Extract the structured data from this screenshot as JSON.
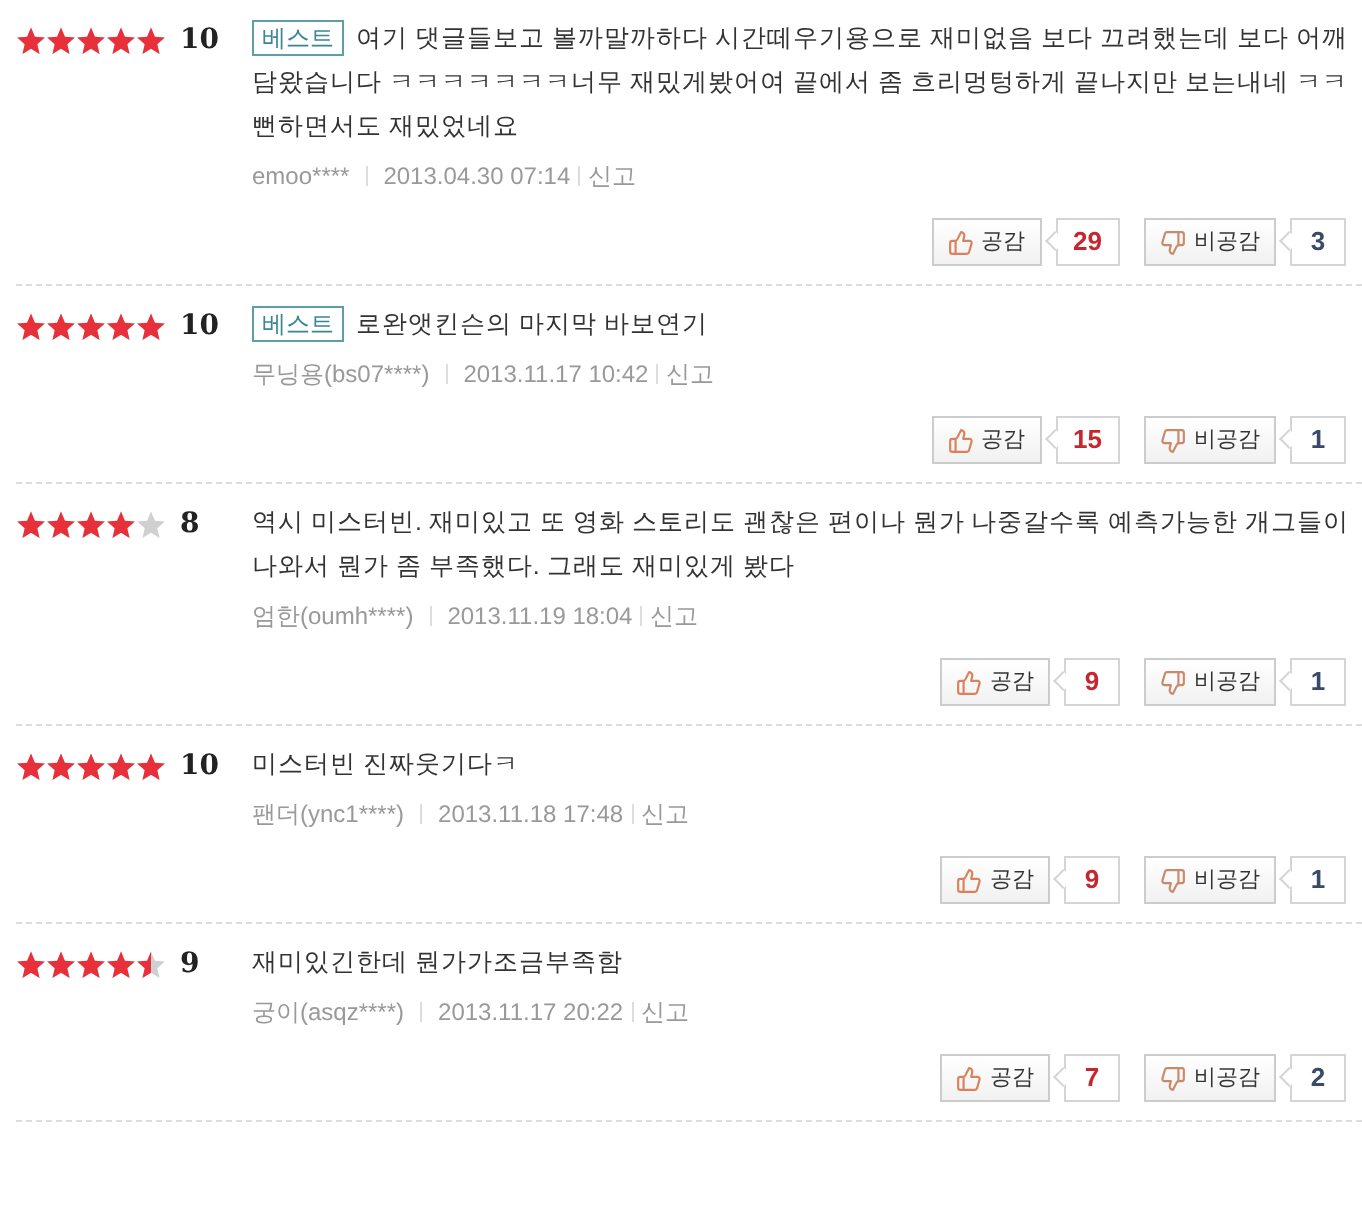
{
  "reviews": [
    {
      "stars": 5,
      "score": "10",
      "best": true,
      "best_label": "베스트",
      "text": "여기 댓글들보고 볼까말까하다 시간떼우기용으로 재미없음 보다 끄려했는데 보다 어깨 담왔습니다 ㅋㅋㅋㅋㅋㅋㅋ너무 재밌게봤어여 끝에서 좀 흐리멍텅하게 끝나지만 보는내네 ㅋㅋ뻔하면서도 재밌었네요",
      "author": "emoo****",
      "date": "2013.04.30 07:14",
      "report": "신고",
      "like_label": "공감",
      "likes": "29",
      "dislike_label": "비공감",
      "dislikes": "3"
    },
    {
      "stars": 5,
      "score": "10",
      "best": true,
      "best_label": "베스트",
      "text": "로완앳킨슨의 마지막 바보연기",
      "author": "무닝용(bs07****)",
      "date": "2013.11.17 10:42",
      "report": "신고",
      "like_label": "공감",
      "likes": "15",
      "dislike_label": "비공감",
      "dislikes": "1"
    },
    {
      "stars": 4,
      "score": "8",
      "best": false,
      "text": "역시 미스터빈. 재미있고 또 영화 스토리도 괜찮은 편이나 뭔가 나중갈수록 예측가능한 개그들이 나와서 뭔가 좀 부족했다. 그래도 재미있게 봤다",
      "author": "엄한(oumh****)",
      "date": "2013.11.19 18:04",
      "report": "신고",
      "like_label": "공감",
      "likes": "9",
      "dislike_label": "비공감",
      "dislikes": "1"
    },
    {
      "stars": 5,
      "score": "10",
      "best": false,
      "text": "미스터빈 진짜웃기다ㅋ",
      "author": "팬더(ync1****)",
      "date": "2013.11.18 17:48",
      "report": "신고",
      "like_label": "공감",
      "likes": "9",
      "dislike_label": "비공감",
      "dislikes": "1"
    },
    {
      "stars": 4.5,
      "score": "9",
      "best": false,
      "text": "재미있긴한데 뭔가가조금부족함",
      "author": "궁이(asqz****)",
      "date": "2013.11.17 20:22",
      "report": "신고",
      "like_label": "공감",
      "likes": "7",
      "dislike_label": "비공감",
      "dislikes": "2"
    }
  ]
}
